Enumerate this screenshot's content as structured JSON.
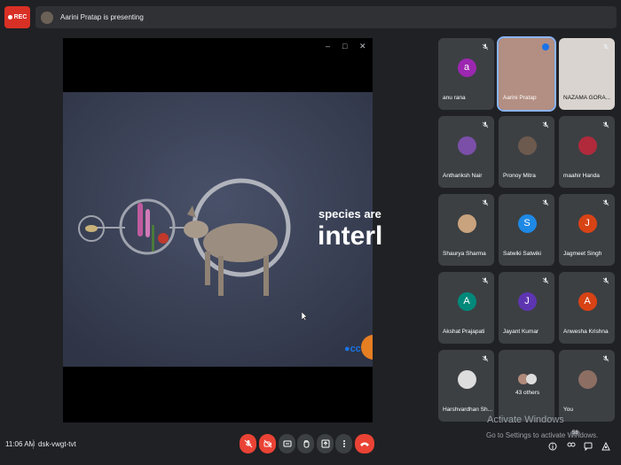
{
  "topbar": {
    "rec_label": "REC",
    "presenting_text": "Aarini Pratap is presenting"
  },
  "slide": {
    "line1": "species are",
    "line2": "interl",
    "logo": "cc"
  },
  "participants": [
    {
      "name": "anu rana",
      "initial": "a",
      "color": "#9c27b0",
      "muted": true
    },
    {
      "name": "Aarini Pratap",
      "initial": "",
      "color": "",
      "muted": false,
      "speaking": true
    },
    {
      "name": "NAZAMA GORA...",
      "initial": "",
      "color": "",
      "muted": true
    },
    {
      "name": "Anthariksh Nair",
      "initial": "",
      "color": "#7b4fa8",
      "muted": true
    },
    {
      "name": "Pronoy Mitra",
      "initial": "",
      "color": "#6d5a4e",
      "muted": true
    },
    {
      "name": "maahir Handa",
      "initial": "",
      "color": "#b02a3c",
      "muted": true
    },
    {
      "name": "Shaurya Sharma",
      "initial": "",
      "color": "#c9a27e",
      "muted": true
    },
    {
      "name": "Satwiki Satwiki",
      "initial": "S",
      "color": "#1e88e5",
      "muted": true
    },
    {
      "name": "Jagmeet Singh",
      "initial": "J",
      "color": "#d84315",
      "muted": true
    },
    {
      "name": "Akshat Prajapati",
      "initial": "A",
      "color": "#00897b",
      "muted": true
    },
    {
      "name": "Jayant Kumar",
      "initial": "J",
      "color": "#5e35b1",
      "muted": true
    },
    {
      "name": "Anwesha Krishna",
      "initial": "A",
      "color": "#d84315",
      "muted": true
    },
    {
      "name": "Harshvardhan Sh...",
      "initial": "",
      "color": "#ddd",
      "muted": true
    },
    {
      "name": "43 others",
      "initial": "",
      "color": "",
      "muted": false
    },
    {
      "name": "You",
      "initial": "",
      "color": "#8d6e63",
      "muted": true
    }
  ],
  "bottom": {
    "time": "11:06 AM",
    "meeting_code": "dsk-vwgt-tvt",
    "people_count": "58"
  },
  "watermark": {
    "line1": "Activate Windows",
    "line2": "Go to Settings to activate Windows."
  }
}
